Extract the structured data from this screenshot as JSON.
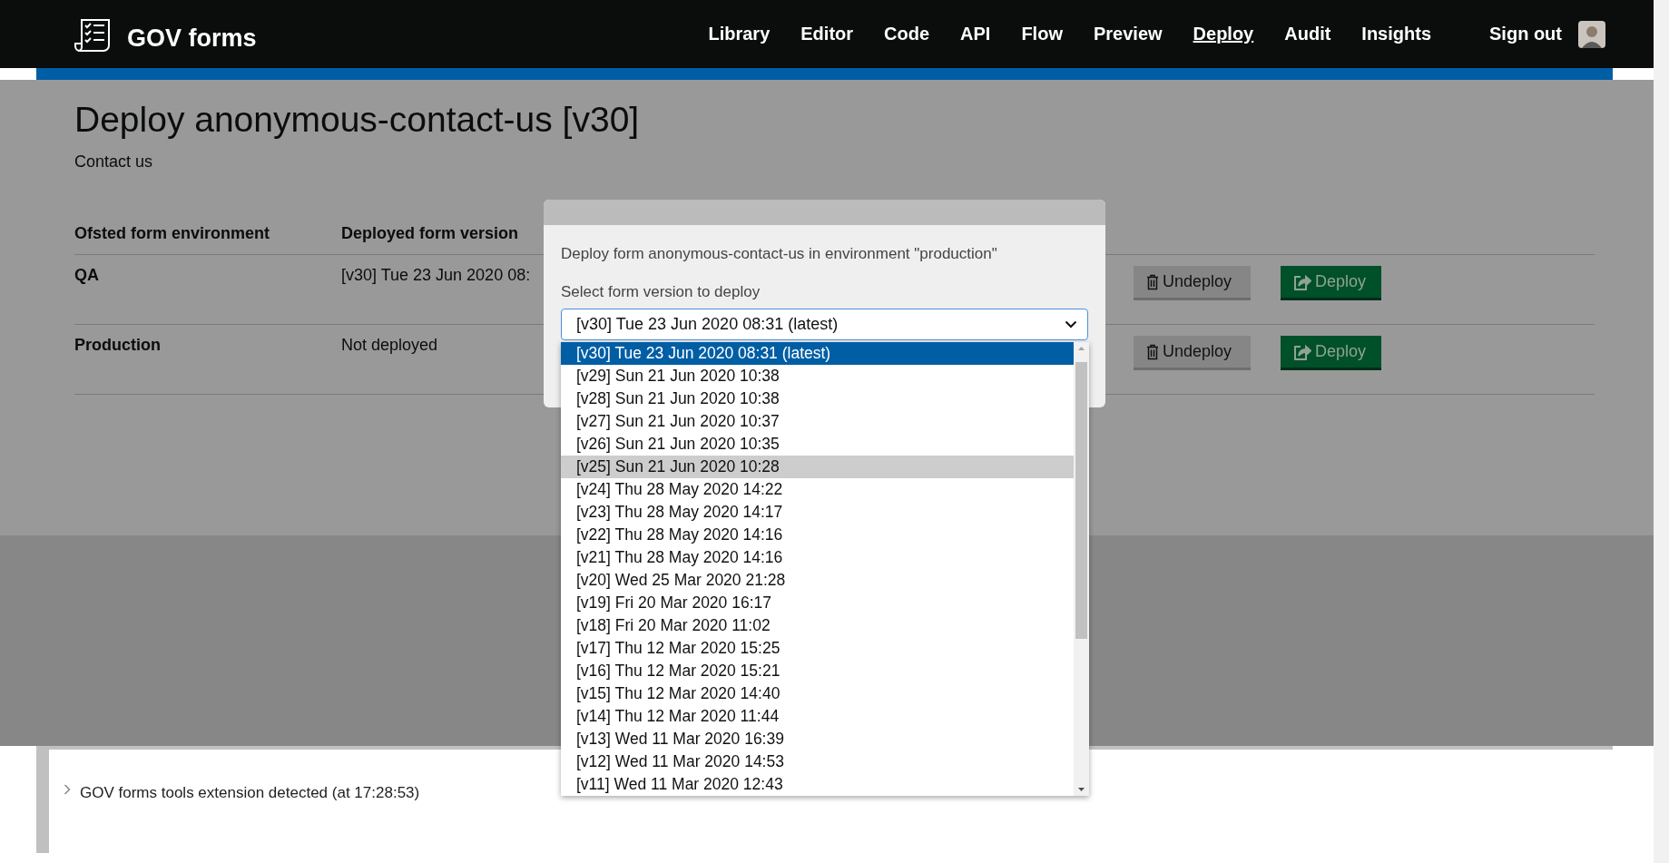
{
  "header": {
    "logo_text": "GOV forms",
    "nav": [
      {
        "label": "Library",
        "selected": false
      },
      {
        "label": "Editor",
        "selected": false
      },
      {
        "label": "Code",
        "selected": false
      },
      {
        "label": "API",
        "selected": false
      },
      {
        "label": "Flow",
        "selected": false
      },
      {
        "label": "Preview",
        "selected": false
      },
      {
        "label": "Deploy",
        "selected": true
      },
      {
        "label": "Audit",
        "selected": false
      },
      {
        "label": "Insights",
        "selected": false
      }
    ],
    "sign_out": "Sign out"
  },
  "page": {
    "title": "Deploy anonymous-contact-us [v30]",
    "subtitle": "Contact us"
  },
  "table": {
    "columns": [
      "Ofsted form environment",
      "Deployed form version"
    ],
    "rows": [
      {
        "environment": "QA",
        "version": "[v30] Tue 23 Jun 2020 08:",
        "undeploy": "Undeploy",
        "deploy": "Deploy"
      },
      {
        "environment": "Production",
        "version": "Not deployed",
        "undeploy": "Undeploy",
        "deploy": "Deploy"
      }
    ]
  },
  "modal": {
    "message": "Deploy form anonymous-contact-us in environment \"production\"",
    "select_label": "Select form version to deploy",
    "select_value": "[v30] Tue 23 Jun 2020 08:31 (latest)",
    "options": [
      {
        "label": "[v30] Tue 23 Jun 2020 08:31 (latest)",
        "selected": true,
        "hovered": false
      },
      {
        "label": "[v29] Sun 21 Jun 2020 10:38",
        "selected": false,
        "hovered": false
      },
      {
        "label": "[v28] Sun 21 Jun 2020 10:38",
        "selected": false,
        "hovered": false
      },
      {
        "label": "[v27] Sun 21 Jun 2020 10:37",
        "selected": false,
        "hovered": false
      },
      {
        "label": "[v26] Sun 21 Jun 2020 10:35",
        "selected": false,
        "hovered": false
      },
      {
        "label": "[v25] Sun 21 Jun 2020 10:28",
        "selected": false,
        "hovered": true
      },
      {
        "label": "[v24] Thu 28 May 2020 14:22",
        "selected": false,
        "hovered": false
      },
      {
        "label": "[v23] Thu 28 May 2020 14:17",
        "selected": false,
        "hovered": false
      },
      {
        "label": "[v22] Thu 28 May 2020 14:16",
        "selected": false,
        "hovered": false
      },
      {
        "label": "[v21] Thu 28 May 2020 14:16",
        "selected": false,
        "hovered": false
      },
      {
        "label": "[v20] Wed 25 Mar 2020 21:28",
        "selected": false,
        "hovered": false
      },
      {
        "label": "[v19] Fri 20 Mar 2020 16:17",
        "selected": false,
        "hovered": false
      },
      {
        "label": "[v18] Fri 20 Mar 2020 11:02",
        "selected": false,
        "hovered": false
      },
      {
        "label": "[v17] Thu 12 Mar 2020 15:25",
        "selected": false,
        "hovered": false
      },
      {
        "label": "[v16] Thu 12 Mar 2020 15:21",
        "selected": false,
        "hovered": false
      },
      {
        "label": "[v15] Thu 12 Mar 2020 14:40",
        "selected": false,
        "hovered": false
      },
      {
        "label": "[v14] Thu 12 Mar 2020 11:44",
        "selected": false,
        "hovered": false
      },
      {
        "label": "[v13] Wed 11 Mar 2020 16:39",
        "selected": false,
        "hovered": false
      },
      {
        "label": "[v12] Wed 11 Mar 2020 14:53",
        "selected": false,
        "hovered": false
      },
      {
        "label": "[v11] Wed 11 Mar 2020 12:43",
        "selected": false,
        "hovered": false
      }
    ]
  },
  "footer": {
    "log_text": "GOV forms tools extension detected (at 17:28:53)"
  }
}
